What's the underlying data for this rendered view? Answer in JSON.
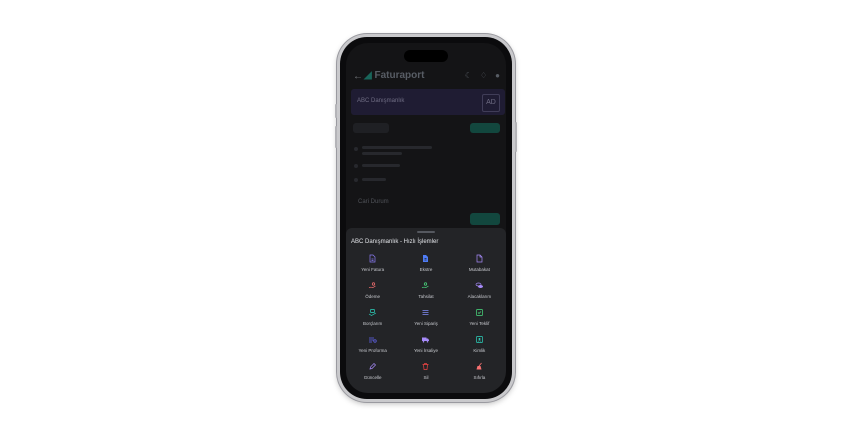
{
  "app": {
    "logo_text": "Faturaport",
    "company_name": "ABC Danışmanlık",
    "company_abbr": "AD",
    "section_label": "Cari Durum"
  },
  "sheet": {
    "title": "ABC Danışmanlık - Hızlı İşlemler",
    "actions": [
      {
        "label": "Yeni Fatura",
        "icon": "invoice-icon",
        "color": "#8b7cf6"
      },
      {
        "label": "Ekstre",
        "icon": "statement-icon",
        "color": "#4f7cf5"
      },
      {
        "label": "Mutabakat",
        "icon": "reconciliation-icon",
        "color": "#a78bfa"
      },
      {
        "label": "Ödeme",
        "icon": "payment-hand-icon",
        "color": "#f87171"
      },
      {
        "label": "Tahsilat",
        "icon": "collection-hand-icon",
        "color": "#4ade80"
      },
      {
        "label": "Alacaklarım",
        "icon": "receivables-icon",
        "color": "#a78bfa"
      },
      {
        "label": "Borçlarım",
        "icon": "debts-icon",
        "color": "#2dd4bf"
      },
      {
        "label": "Yeni Sipariş",
        "icon": "order-list-icon",
        "color": "#818cf8"
      },
      {
        "label": "Yeni Teklif",
        "icon": "offer-icon",
        "color": "#4ade80"
      },
      {
        "label": "Yeni Proforma",
        "icon": "proforma-icon",
        "color": "#6366f1"
      },
      {
        "label": "Yeni İrsaliye",
        "icon": "delivery-truck-icon",
        "color": "#a78bfa"
      },
      {
        "label": "Kimlik",
        "icon": "id-card-icon",
        "color": "#2dd4bf"
      },
      {
        "label": "Güncelle",
        "icon": "edit-pencil-icon",
        "color": "#a78bfa"
      },
      {
        "label": "Sil",
        "icon": "trash-icon",
        "color": "#ef4444"
      },
      {
        "label": "Sıfırla",
        "icon": "reset-broom-icon",
        "color": "#f87171"
      }
    ]
  }
}
